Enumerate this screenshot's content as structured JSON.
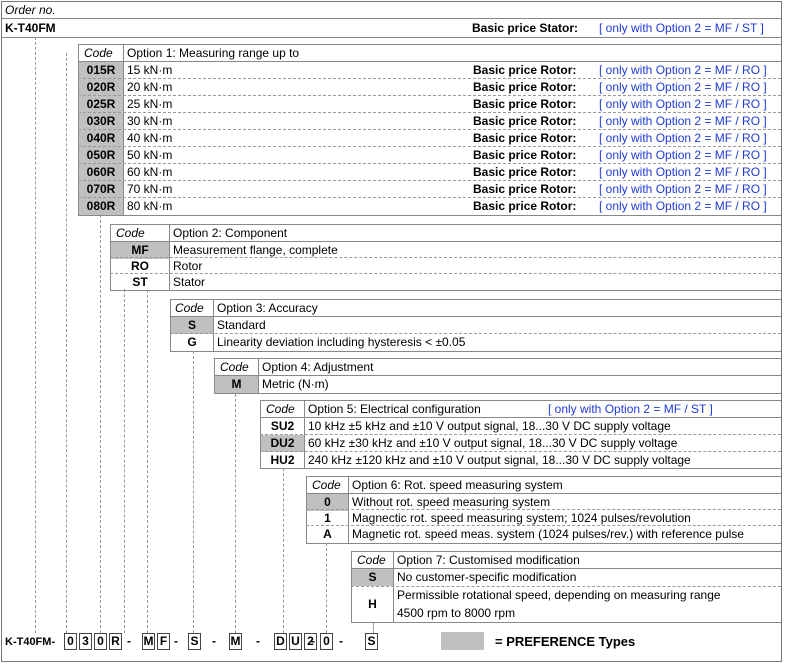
{
  "order_no_label": "Order no.",
  "product_code": "K-T40FM",
  "stator_price_label": "Basic price Stator:",
  "stator_price_note": "[ only with Option 2 = MF / ST ]",
  "code_header": "Code",
  "option1": {
    "title": "Option 1: Measuring range up to",
    "price_label": "Basic price Rotor:",
    "price_note": "[ only with Option 2 = MF / RO ]",
    "rows": [
      {
        "code": "015R",
        "desc": "15 kN·m"
      },
      {
        "code": "020R",
        "desc": "20 kN·m"
      },
      {
        "code": "025R",
        "desc": "25 kN·m"
      },
      {
        "code": "030R",
        "desc": "30 kN·m"
      },
      {
        "code": "040R",
        "desc": "40 kN·m"
      },
      {
        "code": "050R",
        "desc": "50 kN·m"
      },
      {
        "code": "060R",
        "desc": "60 kN·m"
      },
      {
        "code": "070R",
        "desc": "70 kN·m"
      },
      {
        "code": "080R",
        "desc": "80 kN·m"
      }
    ]
  },
  "option2": {
    "title": "Option 2: Component",
    "rows": [
      {
        "code": "MF",
        "desc": "Measurement flange, complete"
      },
      {
        "code": "RO",
        "desc": "Rotor"
      },
      {
        "code": "ST",
        "desc": "Stator"
      }
    ]
  },
  "option3": {
    "title": "Option 3: Accuracy",
    "rows": [
      {
        "code": "S",
        "desc": "Standard"
      },
      {
        "code": "G",
        "desc": "Linearity deviation including hysteresis  < ±0.05"
      }
    ]
  },
  "option4": {
    "title": "Option 4: Adjustment",
    "rows": [
      {
        "code": "M",
        "desc": "Metric (N·m)"
      }
    ]
  },
  "option5": {
    "title": "Option 5: Electrical configuration",
    "note": "[ only with Option 2 = MF / ST ]",
    "rows": [
      {
        "code": "SU2",
        "desc": "10 kHz ±5 kHz and ±10 V output signal, 18...30 V DC supply voltage"
      },
      {
        "code": "DU2",
        "desc": "60 kHz ±30 kHz and ±10 V output signal, 18...30 V DC supply voltage"
      },
      {
        "code": "HU2",
        "desc": "240 kHz ±120 kHz and ±10 V output signal, 18...30 V DC supply voltage"
      }
    ]
  },
  "option6": {
    "title": "Option 6: Rot. speed measuring system",
    "rows": [
      {
        "code": "0",
        "desc": "Without rot. speed measuring system"
      },
      {
        "code": "1",
        "desc": "Magnectic rot. speed measuring system; 1024 pulses/revolution"
      },
      {
        "code": "A",
        "desc": "Magnetic rot. speed meas. system (1024 pulses/rev.) with reference pulse"
      }
    ]
  },
  "option7": {
    "title": "Option 7: Customised modification",
    "rows": [
      {
        "code": "S",
        "desc": "No customer-specific modification"
      },
      {
        "code": "H",
        "desc": "Permissible rotational speed, depending on measuring range",
        "desc2": "4500 rpm to 8000 rpm"
      }
    ]
  },
  "order_line": {
    "prefix": "K-T40FM-",
    "chars": [
      "0",
      "3",
      "0",
      "R",
      "M",
      "F",
      "S",
      "M",
      "D",
      "U",
      "2",
      "0",
      "S"
    ],
    "separator": "-"
  },
  "legend": {
    "label": "= PREFERENCE Types",
    "color": "#c0c0c0"
  }
}
